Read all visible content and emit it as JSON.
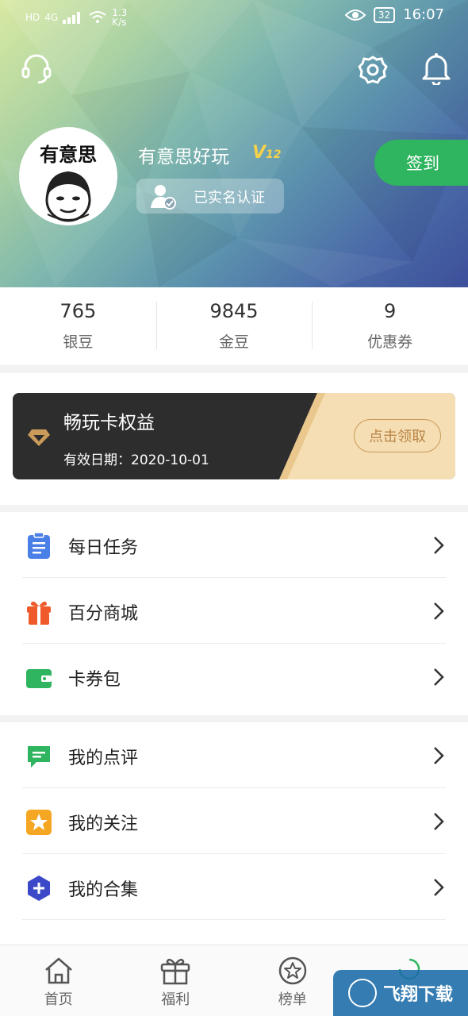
{
  "status_bar": {
    "network_hd": "HD",
    "network_gen": "4G",
    "speed_top": "1.3",
    "speed_bottom": "K/s",
    "battery": "32",
    "time": "16:07"
  },
  "header": {
    "avatar_text": "有意思",
    "username": "有意思好玩",
    "vip_prefix": "V",
    "vip_level": "12",
    "verified_label": "已实名认证",
    "signin_label": "签到"
  },
  "stats": [
    {
      "value": "765",
      "label": "银豆"
    },
    {
      "value": "9845",
      "label": "金豆"
    },
    {
      "value": "9",
      "label": "优惠券"
    }
  ],
  "card": {
    "title": "畅玩卡权益",
    "validity": "有效日期：2020-10-01",
    "button": "点击领取"
  },
  "menu_group_1": [
    {
      "label": "每日任务",
      "icon": "clipboard-icon"
    },
    {
      "label": "百分商城",
      "icon": "gift-icon"
    },
    {
      "label": "卡券包",
      "icon": "wallet-icon"
    }
  ],
  "menu_group_2": [
    {
      "label": "我的点评",
      "icon": "comment-icon"
    },
    {
      "label": "我的关注",
      "icon": "star-icon"
    },
    {
      "label": "我的合集",
      "icon": "collection-icon"
    }
  ],
  "tabbar": [
    {
      "label": "首页",
      "icon": "home-icon"
    },
    {
      "label": "福利",
      "icon": "gift-icon"
    },
    {
      "label": "榜单",
      "icon": "star-badge-icon"
    }
  ],
  "watermark": {
    "text": "飞翔下载"
  },
  "colors": {
    "accent_green": "#2fb45f",
    "card_dark": "#2d2d2d",
    "card_cream": "#f5deb3",
    "gold": "#c99a5a"
  }
}
